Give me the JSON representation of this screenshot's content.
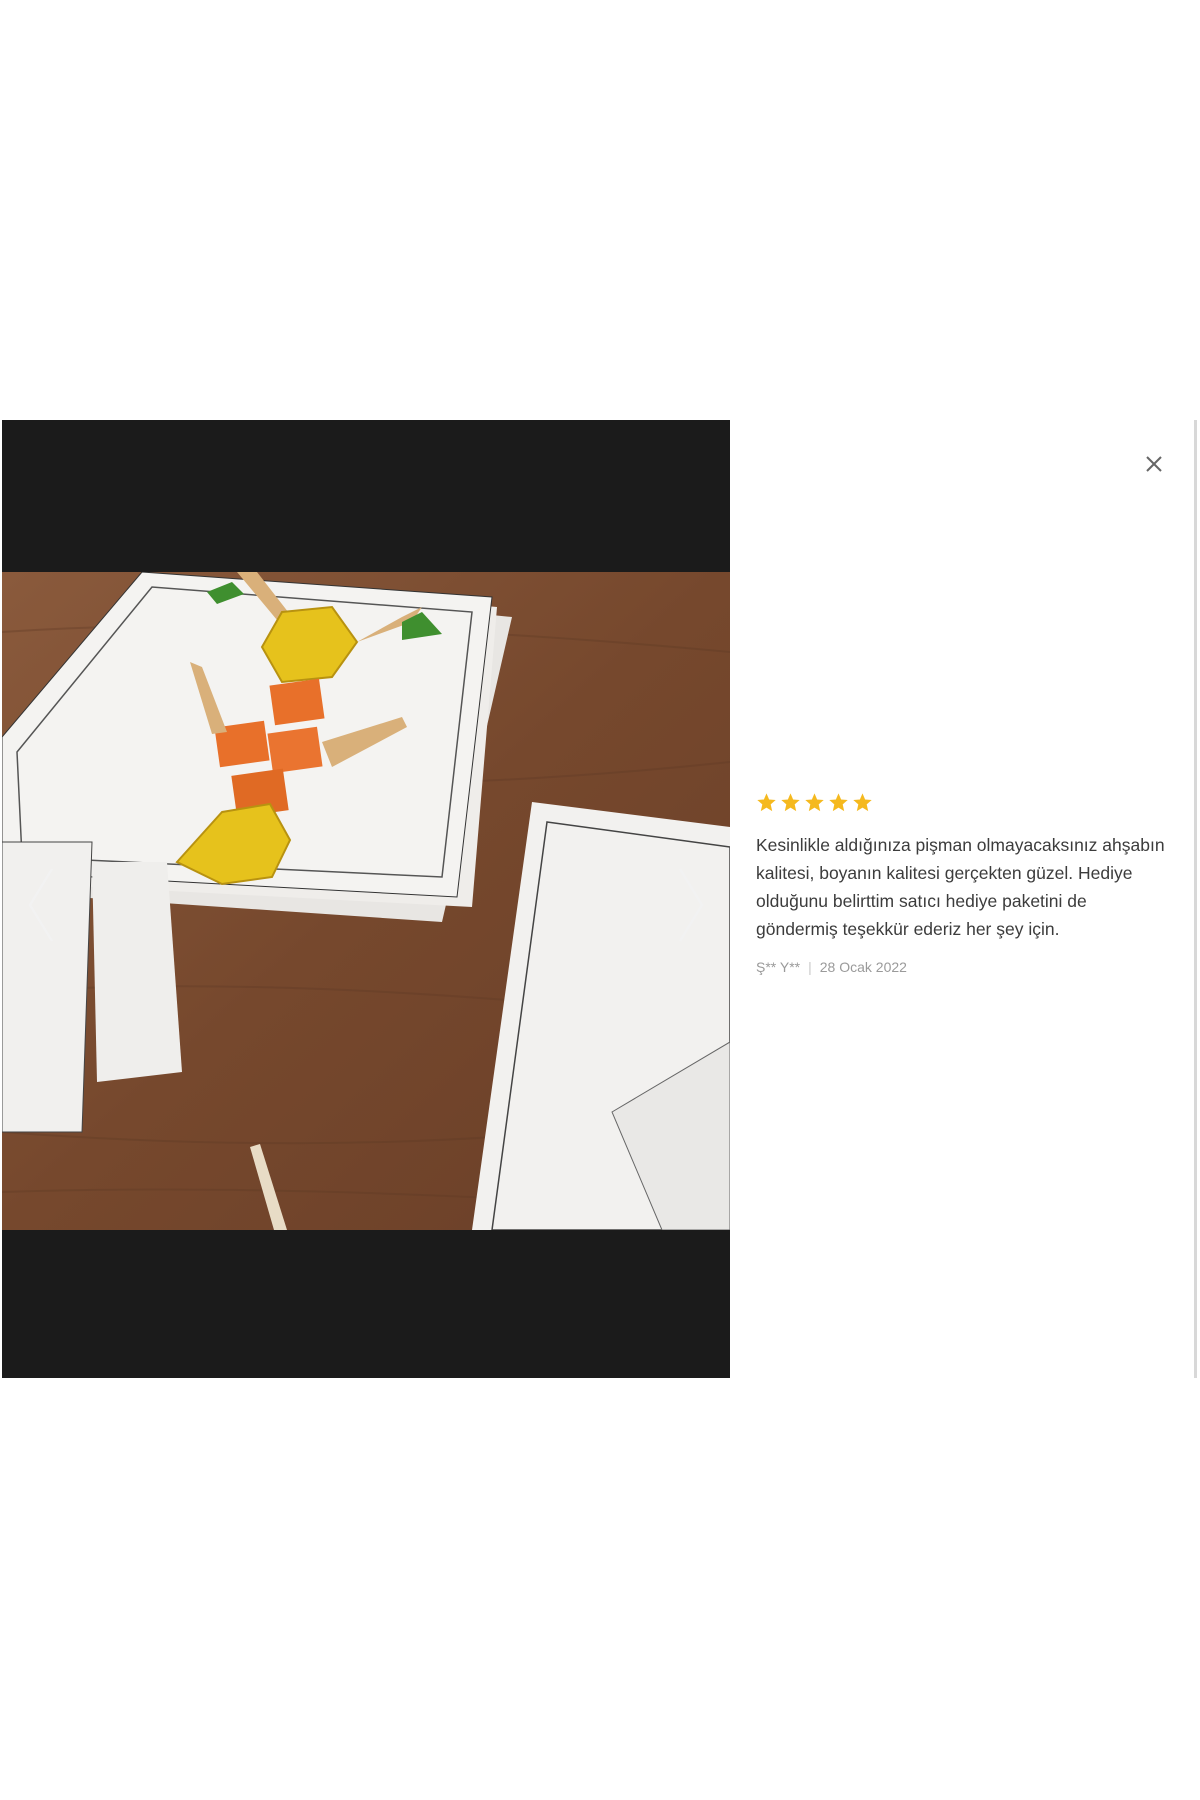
{
  "review": {
    "rating": 5,
    "max_rating": 5,
    "text": "Kesinlikle aldığınıza pişman olmayacaksınız ahşabın kalitesi, boyanın kalitesi gerçekten güzel. Hediye olduğunu belirttim satıcı hediye paketini de göndermiş teşekkür ederiz her şey için.",
    "author": "Ş** Y**",
    "separator": "|",
    "date": "28 Ocak 2022"
  },
  "icons": {
    "close": "close-icon",
    "prev": "chevron-left-icon",
    "next": "chevron-right-icon",
    "star": "star-icon"
  },
  "colors": {
    "star": "#f5b91e",
    "backdrop": "#1b1b1b"
  }
}
